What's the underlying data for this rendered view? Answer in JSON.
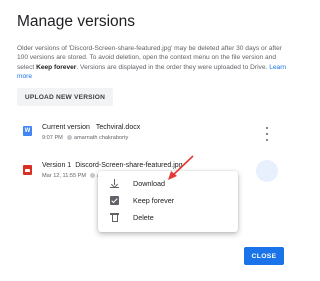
{
  "dialog": {
    "title": "Manage versions",
    "description": {
      "part1": "Older versions of 'Discord-Screen-share-featured.jpg' may be deleted after 30 days or after 100 versions are stored. To avoid deletion, open the context menu on the file version and select ",
      "bold": "Keep forever",
      "part2": ". Versions are displayed in the order they were uploaded to Drive. ",
      "link": "Learn more"
    },
    "upload_button": "UPLOAD NEW VERSION",
    "close_button": "CLOSE"
  },
  "versions": [
    {
      "label": "Current version",
      "filename": "Techviral.docx",
      "date": "9:07 PM",
      "user": "amarnath chakraborty",
      "icon": "word-doc-icon"
    },
    {
      "label": "Version 1",
      "filename": "Discord-Screen-share-featured.jpg",
      "date": "Mar 12, 11:55 PM",
      "user": "a",
      "icon": "image-file-icon"
    }
  ],
  "context_menu": {
    "items": [
      {
        "label": "Download",
        "icon": "download-icon"
      },
      {
        "label": "Keep forever",
        "icon": "checkbox-icon"
      },
      {
        "label": "Delete",
        "icon": "trash-icon"
      }
    ]
  },
  "colors": {
    "accent": "#1a73e8",
    "annotation_arrow": "#e53935",
    "word_icon": "#4285f4",
    "image_icon": "#d93025"
  }
}
